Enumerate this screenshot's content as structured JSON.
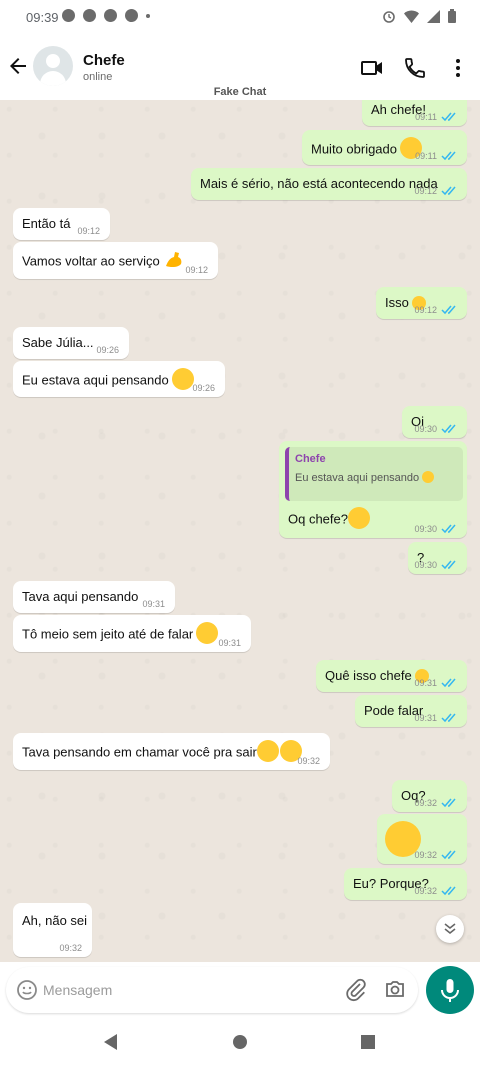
{
  "status_bar": {
    "time": "09:39"
  },
  "header": {
    "title": "Chefe",
    "subtitle": "online"
  },
  "chat_label": "Fake Chat",
  "messages": [
    {
      "dir": "out",
      "text": "Ah chefe!",
      "time": "09:11"
    },
    {
      "dir": "out",
      "text": "Muito obrigado",
      "time": "09:11",
      "emoji": "smiling-face"
    },
    {
      "dir": "out",
      "text": "Mais é sério, não está acontecendo nada",
      "time": "09:12"
    },
    {
      "dir": "in",
      "text": "Então tá",
      "time": "09:12"
    },
    {
      "dir": "in",
      "text": "Vamos voltar ao serviço",
      "time": "09:12",
      "emoji": "flexed-biceps"
    },
    {
      "dir": "out",
      "text": "Isso",
      "time": "09:12",
      "emoji": "slightly-frowning-face"
    },
    {
      "dir": "in",
      "text": "Sabe Júlia...",
      "time": "09:26"
    },
    {
      "dir": "in",
      "text": "Eu estava aqui pensando",
      "time": "09:26",
      "emoji": "thinking-face"
    },
    {
      "dir": "out",
      "text": "Oi",
      "time": "09:30"
    },
    {
      "dir": "out",
      "text": "Oq chefe?",
      "time": "09:30",
      "emoji": "thinking-face",
      "reply_to": {
        "name": "Chefe",
        "text": "Eu estava aqui pensando"
      }
    },
    {
      "dir": "out",
      "text": "?",
      "time": "09:30"
    },
    {
      "dir": "in",
      "text": "Tava aqui pensando",
      "time": "09:31"
    },
    {
      "dir": "in",
      "text": "Tô meio sem jeito até de falar",
      "time": "09:31",
      "emoji": "grinning-sweat-face"
    },
    {
      "dir": "out",
      "text": "Quê isso chefe",
      "time": "09:31",
      "emoji": "face-with-hand-over-mouth"
    },
    {
      "dir": "out",
      "text": "Pode falar",
      "time": "09:31"
    },
    {
      "dir": "in",
      "text": "Tava pensando em chamar você pra sair",
      "time": "09:32",
      "emoji": "drooling-face, smiling-face-blushing"
    },
    {
      "dir": "out",
      "text": "Oq?",
      "time": "09:32"
    },
    {
      "dir": "out",
      "text": "",
      "time": "09:32",
      "emoji": "flushed-face"
    },
    {
      "dir": "out",
      "text": "Eu? Porque?",
      "time": "09:32"
    },
    {
      "dir": "in",
      "text": "Ah, não sei",
      "time": "09:32"
    }
  ],
  "composer": {
    "placeholder": "Mensagem"
  },
  "colors": {
    "header_bg": "#ffffff",
    "chat_bg": "#ece5dd",
    "outgoing_bubble": "#dcf8c6",
    "incoming_bubble": "#ffffff",
    "accent": "#00897b",
    "read_ticks": "#34b7f1",
    "reply_bar": "#8e44ad"
  },
  "icons": [
    "back-arrow-icon",
    "video-call-icon",
    "phone-icon",
    "more-vert-icon",
    "emoji-icon",
    "attach-icon",
    "camera-icon",
    "mic-icon",
    "scroll-down-icon",
    "nav-back-icon",
    "nav-home-icon",
    "nav-recents-icon"
  ]
}
